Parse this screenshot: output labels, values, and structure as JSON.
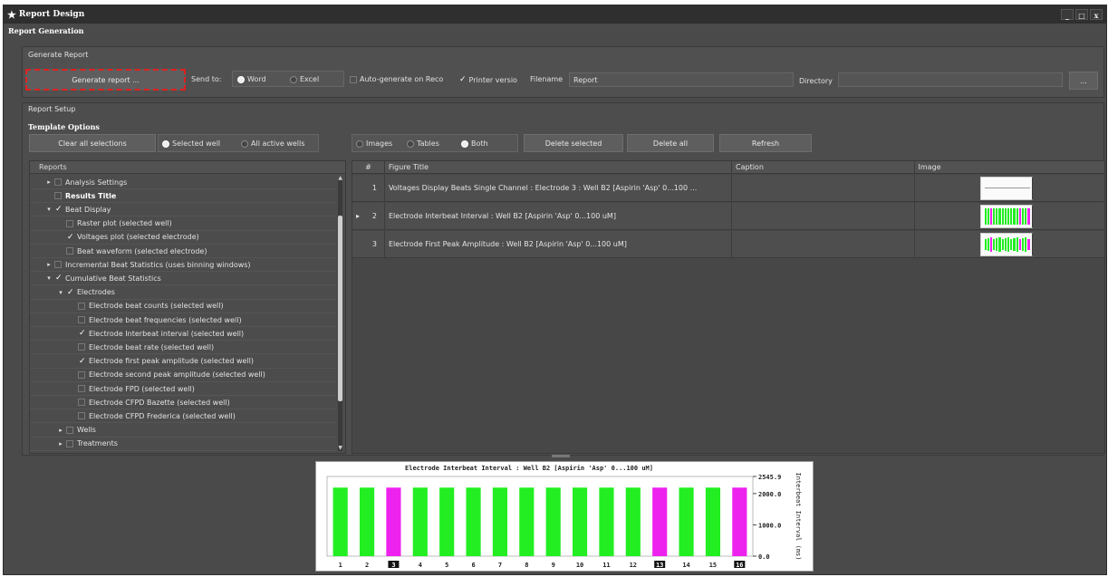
{
  "window": {
    "title": "Report Design",
    "subtitle": "Report Generation",
    "buttons": [
      "_",
      "□",
      "x"
    ]
  },
  "generate": {
    "section": "Generate Report",
    "button": "Generate report ...",
    "send_to_label": "Send to:",
    "send_word": "Word",
    "send_excel": "Excel",
    "auto_generate": "Auto-generate on Reco",
    "printer_version": "Printer versio",
    "filename_label": "Filename",
    "filename_value": "Report",
    "directory_label": "Directory",
    "directory_value": "",
    "browse": "..."
  },
  "setup": {
    "section": "Report Setup",
    "template_options": "Template Options",
    "clear_all": "Clear all selections",
    "selected_well": "Selected well",
    "all_active_wells": "All active wells"
  },
  "toolbar": {
    "images": "Images",
    "tables": "Tables",
    "both": "Both",
    "delete_selected": "Delete selected",
    "delete_all": "Delete all",
    "refresh": "Refresh"
  },
  "tree": {
    "header": "Reports",
    "rows": [
      {
        "label": "Analysis Settings",
        "indent": 1,
        "arrow": "▸",
        "checked": false,
        "bold": false
      },
      {
        "label": "Results Title",
        "indent": 1,
        "arrow": "",
        "checked": false,
        "bold": true
      },
      {
        "label": "Beat Display",
        "indent": 1,
        "arrow": "▾",
        "checked": true,
        "bold": false
      },
      {
        "label": "Raster plot (selected well)",
        "indent": 2,
        "arrow": "",
        "checked": false,
        "bold": false
      },
      {
        "label": "Voltages plot (selected electrode)",
        "indent": 2,
        "arrow": "",
        "checked": true,
        "bold": false
      },
      {
        "label": "Beat waveform (selected electrode)",
        "indent": 2,
        "arrow": "",
        "checked": false,
        "bold": false
      },
      {
        "label": "Incremental Beat Statistics (uses binning windows)",
        "indent": 1,
        "arrow": "▸",
        "checked": false,
        "bold": false
      },
      {
        "label": "Cumulative Beat Statistics",
        "indent": 1,
        "arrow": "▾",
        "checked": true,
        "bold": false
      },
      {
        "label": "Electrodes",
        "indent": 2,
        "arrow": "▾",
        "checked": true,
        "bold": false
      },
      {
        "label": "Electrode beat counts (selected well)",
        "indent": 3,
        "arrow": "",
        "checked": false,
        "bold": false
      },
      {
        "label": "Electrode beat frequencies (selected well)",
        "indent": 3,
        "arrow": "",
        "checked": false,
        "bold": false
      },
      {
        "label": "Electrode Interbeat interval (selected well)",
        "indent": 3,
        "arrow": "",
        "checked": true,
        "bold": false
      },
      {
        "label": "Electrode beat rate (selected well)",
        "indent": 3,
        "arrow": "",
        "checked": false,
        "bold": false
      },
      {
        "label": "Electrode first peak amplitude (selected well)",
        "indent": 3,
        "arrow": "",
        "checked": true,
        "bold": false
      },
      {
        "label": "Electrode second peak amplitude (selected well)",
        "indent": 3,
        "arrow": "",
        "checked": false,
        "bold": false
      },
      {
        "label": "Electrode FPD (selected well)",
        "indent": 3,
        "arrow": "",
        "checked": false,
        "bold": false
      },
      {
        "label": "Electrode CFPD Bazette (selected well)",
        "indent": 3,
        "arrow": "",
        "checked": false,
        "bold": false
      },
      {
        "label": "Electrode CFPD Frederica (selected well)",
        "indent": 3,
        "arrow": "",
        "checked": false,
        "bold": false
      },
      {
        "label": "Wells",
        "indent": 2,
        "arrow": "▸",
        "checked": false,
        "bold": false
      },
      {
        "label": "Treatments",
        "indent": 2,
        "arrow": "▸",
        "checked": false,
        "bold": false
      }
    ]
  },
  "grid": {
    "columns": [
      "#",
      "Figure Title",
      "Caption",
      "Image"
    ],
    "rows": [
      {
        "num": "1",
        "title": "Voltages Display Beats Single Channel : Electrode 3 : Well B2 [Aspirin 'Asp' 0...100 ...",
        "caption": "",
        "thumb": "voltage",
        "marker": ""
      },
      {
        "num": "2",
        "title": "Electrode Interbeat Interval : Well B2 [Aspirin 'Asp' 0...100 uM]",
        "caption": "",
        "thumb": "bars",
        "marker": "▸"
      },
      {
        "num": "3",
        "title": "Electrode First Peak Amplitude : Well B2 [Aspirin 'Asp' 0...100 uM]",
        "caption": "",
        "thumb": "bars2",
        "marker": ""
      }
    ]
  },
  "chart_data": {
    "type": "bar",
    "title": "Electrode Interbeat Interval : Well B2 [Aspirin 'Asp' 0...100 uM]",
    "ylabel": "Interbeat Interval (ms)",
    "ylim": [
      0,
      2545.9
    ],
    "yticks": [
      "2545.9",
      "2000.0",
      "1000.0",
      "0.0"
    ],
    "categories": [
      "1",
      "2",
      "3",
      "4",
      "5",
      "6",
      "7",
      "8",
      "9",
      "10",
      "11",
      "12",
      "13",
      "14",
      "15",
      "16"
    ],
    "values": [
      2190,
      2190,
      2190,
      2190,
      2190,
      2190,
      2190,
      2190,
      2190,
      2190,
      2190,
      2190,
      2190,
      2190,
      2190,
      2190
    ],
    "highlighted": [
      "3",
      "13",
      "16"
    ],
    "colors": [
      "#22ee22",
      "#22ee22",
      "#ee22ee",
      "#22ee22",
      "#22ee22",
      "#22ee22",
      "#22ee22",
      "#22ee22",
      "#22ee22",
      "#22ee22",
      "#22ee22",
      "#22ee22",
      "#ee22ee",
      "#22ee22",
      "#22ee22",
      "#ee22ee"
    ]
  }
}
